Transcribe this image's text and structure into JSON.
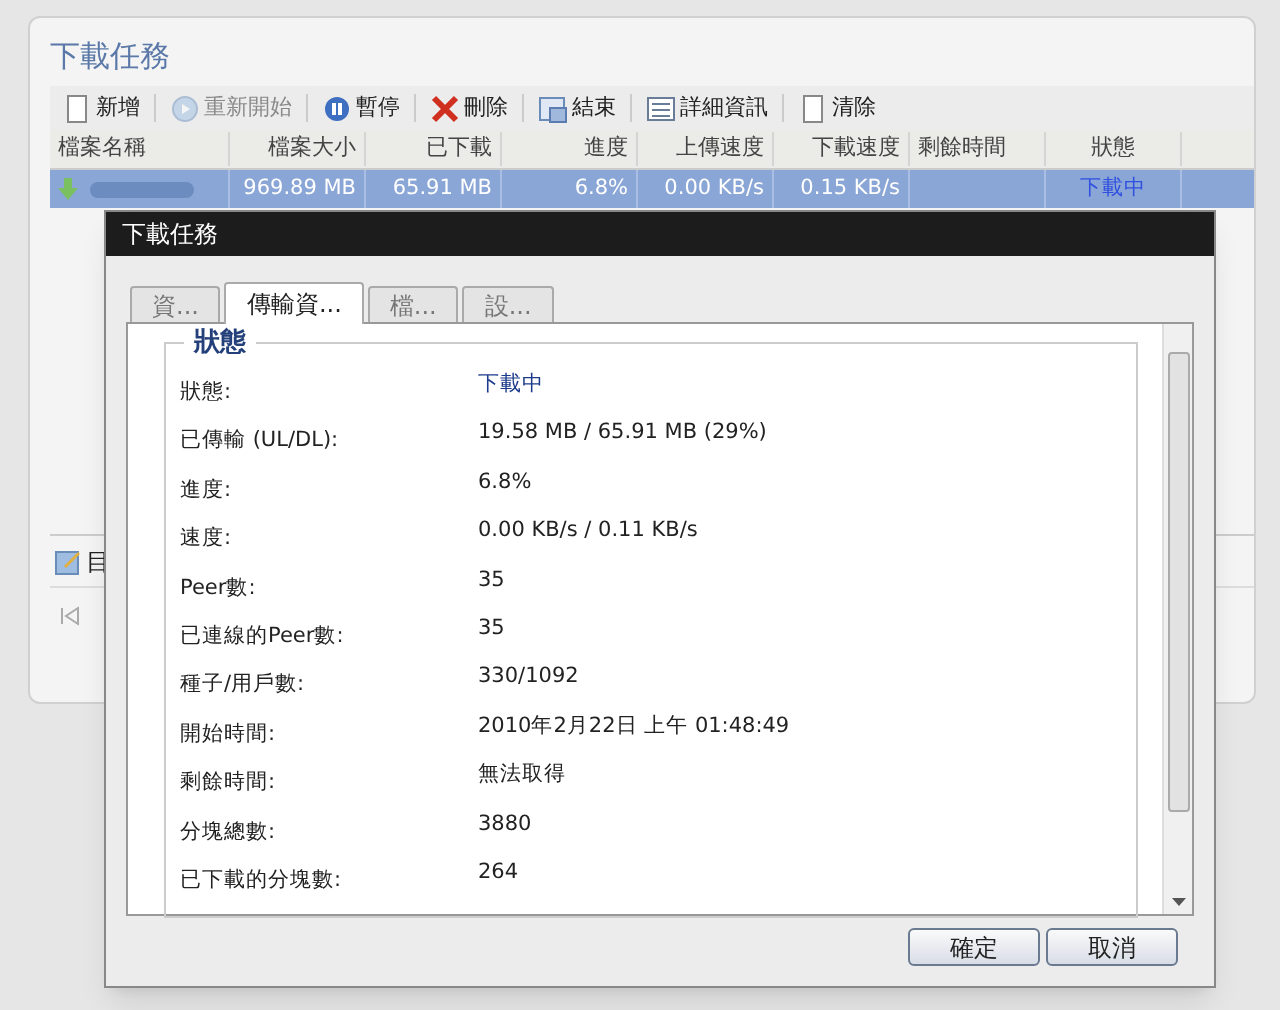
{
  "window": {
    "title": "下載任務"
  },
  "toolbar": [
    {
      "label": "新增",
      "disabled": false
    },
    {
      "label": "重新開始",
      "disabled": true
    },
    {
      "label": "暫停",
      "disabled": false
    },
    {
      "label": "刪除",
      "disabled": false
    },
    {
      "label": "結束",
      "disabled": false
    },
    {
      "label": "詳細資訊",
      "disabled": false
    },
    {
      "label": "清除",
      "disabled": false
    }
  ],
  "table": {
    "columns": [
      "檔案名稱",
      "檔案大小",
      "已下載",
      "進度",
      "上傳速度",
      "下載速度",
      "剩餘時間",
      "狀態"
    ],
    "rows": [
      {
        "selected": true,
        "cells": [
          "",
          "969.89 MB",
          "65.91 MB",
          "6.8%",
          "0.00 KB/s",
          "0.15 KB/s",
          "",
          "下載中"
        ]
      }
    ]
  },
  "bottom_bar": {
    "label": "目"
  },
  "dialog": {
    "title": "下載任務",
    "tabs": [
      {
        "label": "資...",
        "selected": false
      },
      {
        "label": "傳輸資...",
        "selected": true
      },
      {
        "label": "檔...",
        "selected": false
      },
      {
        "label": "設...",
        "selected": false
      }
    ],
    "group": "狀態",
    "fields": [
      {
        "label": "狀態:",
        "value": "下載中",
        "kind": "status"
      },
      {
        "label": "已傳輸 (UL/DL):",
        "value": "19.58 MB / 65.91 MB (29%)",
        "kind": "text"
      },
      {
        "label": "進度:",
        "value": "6.8%",
        "kind": "text"
      },
      {
        "label": "速度:",
        "value": "0.00 KB/s / 0.11 KB/s",
        "kind": "text"
      },
      {
        "label": "Peer數:",
        "value": "35",
        "kind": "text"
      },
      {
        "label": "已連線的Peer數:",
        "value": "35",
        "kind": "text"
      },
      {
        "label": "種子/用戶數:",
        "value": "330/1092",
        "kind": "text"
      },
      {
        "label": "開始時間:",
        "value": "2010年2月22日 上午 01:48:49",
        "kind": "text"
      },
      {
        "label": "剩餘時間:",
        "value": "無法取得",
        "kind": "text"
      },
      {
        "label": "分塊總數:",
        "value": "3880",
        "kind": "text"
      },
      {
        "label": "已下載的分塊數:",
        "value": "264",
        "kind": "text"
      }
    ],
    "buttons": [
      "確定",
      "取消"
    ]
  }
}
